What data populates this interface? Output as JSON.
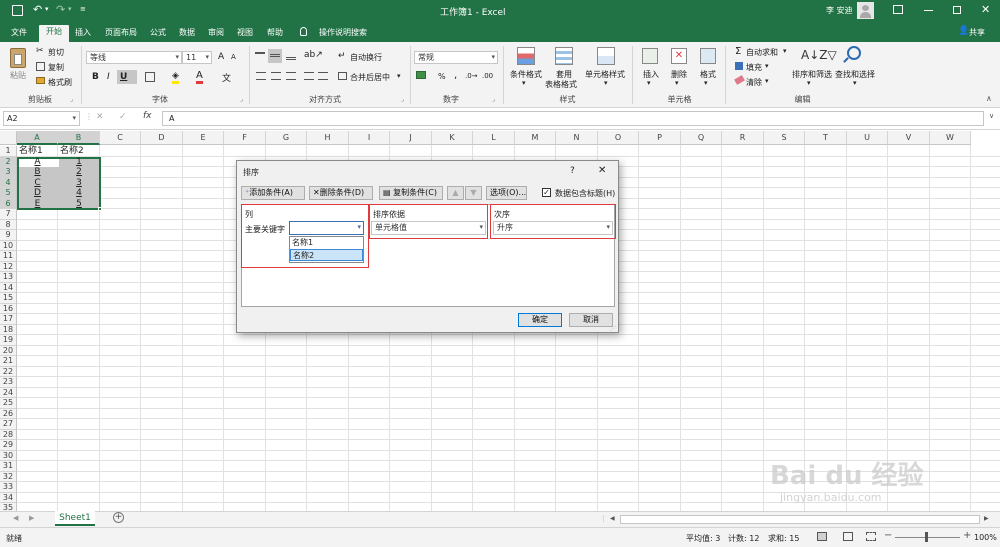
{
  "titlebar": {
    "title": "工作簿1 - Excel",
    "user": "李 安迪",
    "share": "共享"
  },
  "tabs": [
    "文件",
    "开始",
    "插入",
    "页面布局",
    "公式",
    "数据",
    "审阅",
    "视图",
    "帮助",
    "操作说明搜索"
  ],
  "ribbon": {
    "clipboard": {
      "paste": "粘贴",
      "cut": "剪切",
      "copy": "复制",
      "format_painter": "格式刷",
      "label": "剪贴板"
    },
    "font": {
      "name": "等线",
      "size": "11",
      "bold": "B",
      "italic": "I",
      "underline": "U",
      "label": "字体",
      "grow": "A",
      "shrink": "A"
    },
    "alignment": {
      "wrap": "自动换行",
      "merge": "合并后居中",
      "label": "对齐方式"
    },
    "number": {
      "format": "常规",
      "label": "数字",
      "percent": "%",
      "comma": ","
    },
    "styles": {
      "conditional": "条件格式",
      "table_line1": "套用",
      "table_line2": "表格格式",
      "cell": "单元格样式",
      "label": "样式"
    },
    "cells": {
      "insert": "插入",
      "delete": "删除",
      "format": "格式",
      "label": "单元格"
    },
    "editing": {
      "autosum": "自动求和",
      "fill": "填充",
      "clear": "清除",
      "sort_filter": "排序和筛选",
      "find_select": "查找和选择",
      "label": "编辑"
    }
  },
  "formula_bar": {
    "name_box": "A2",
    "fx": "fx",
    "value": "A"
  },
  "sheet": {
    "columns": [
      "A",
      "B",
      "C",
      "D",
      "E",
      "F",
      "G",
      "H",
      "I",
      "J",
      "K",
      "L",
      "M",
      "N",
      "O",
      "P",
      "Q",
      "R",
      "S",
      "T",
      "U",
      "V",
      "W"
    ],
    "rows": [
      "1",
      "2",
      "3",
      "4",
      "5",
      "6",
      "7",
      "8",
      "9",
      "10",
      "11",
      "12",
      "13",
      "14",
      "15",
      "16",
      "17",
      "18",
      "19",
      "20",
      "21",
      "22",
      "23",
      "24",
      "25",
      "26",
      "27",
      "28",
      "29",
      "30",
      "31",
      "32",
      "33",
      "34",
      "35"
    ],
    "cells": [
      [
        "名称1",
        "名称2"
      ],
      [
        "A",
        "1"
      ],
      [
        "B",
        "2"
      ],
      [
        "C",
        "3"
      ],
      [
        "D",
        "4"
      ],
      [
        "E",
        "5"
      ]
    ]
  },
  "dialog": {
    "title": "排序",
    "help": "?",
    "close": "✕",
    "add_level": "添加条件(A)",
    "delete_level": "删除条件(D)",
    "copy_level": "复制条件(C)",
    "options": "选项(O)...",
    "has_headers": "数据包含标题(H)",
    "col_header": "列",
    "sorton_header": "排序依据",
    "order_header": "次序",
    "row_label": "主要关键字",
    "key_value": "",
    "sorton_value": "单元格值",
    "order_value": "升序",
    "dropdown_options": [
      "名称1",
      "名称2"
    ],
    "ok": "确定",
    "cancel": "取消"
  },
  "sheet_tabs": {
    "active": "Sheet1",
    "add": "+"
  },
  "status": {
    "ready": "就绪",
    "average": "平均值: 3",
    "count": "计数: 12",
    "sum": "求和: 15",
    "zoom": "100%"
  },
  "watermark": {
    "brand": "Bai du 经验",
    "url": "jingyan.baidu.com"
  },
  "colors": {
    "excel_green": "#217346",
    "highlight_red": "#e0393e",
    "selection_blue": "#cce4f7"
  }
}
